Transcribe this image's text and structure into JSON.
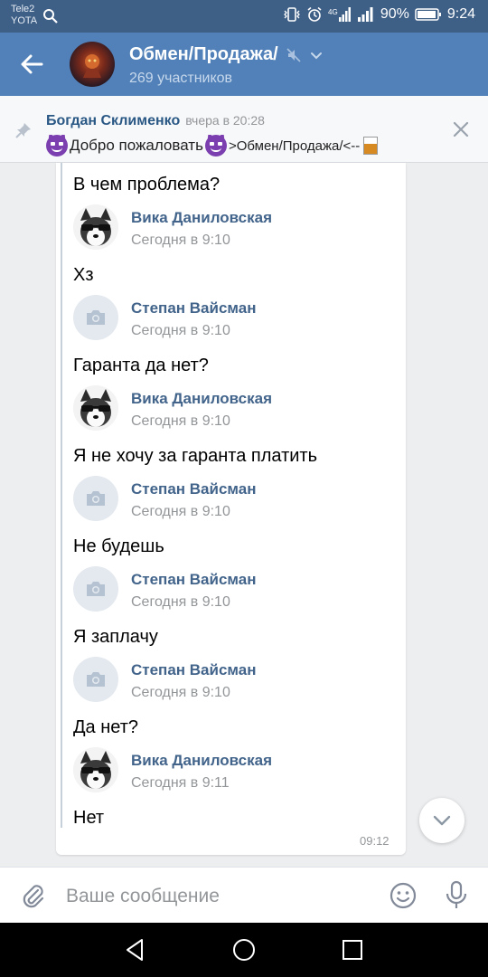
{
  "status_bar": {
    "carrier_line1": "Tele2",
    "carrier_line2": "YOTA",
    "battery": "90%",
    "time": "9:24"
  },
  "header": {
    "title": "Обмен/Продажа/",
    "subtitle": "269 участников",
    "back_icon": "arrow-left-icon",
    "mute_icon": "muted-speaker-icon",
    "dropdown_icon": "chevron-down-icon"
  },
  "pinned": {
    "author": "Богдан Склименко",
    "time": "вчера в 20:28",
    "text_part1": "Добро пожаловать",
    "text_part2": ">Обмен/Продажа/<--"
  },
  "thread": [
    {
      "type": "text",
      "text": "В чем проблема?"
    },
    {
      "type": "author",
      "name": "Вика Даниловская",
      "date": "Сегодня в 9:10",
      "avatar": "dog-sunglasses"
    },
    {
      "type": "text",
      "text": "Хз"
    },
    {
      "type": "author",
      "name": "Степан Вайсман",
      "date": "Сегодня в 9:10",
      "avatar": "camera-placeholder"
    },
    {
      "type": "text",
      "text": "Гаранта да нет?"
    },
    {
      "type": "author",
      "name": "Вика Даниловская",
      "date": "Сегодня в 9:10",
      "avatar": "dog-sunglasses"
    },
    {
      "type": "text",
      "text": "Я не хочу за гаранта платить"
    },
    {
      "type": "author",
      "name": "Степан Вайсман",
      "date": "Сегодня в 9:10",
      "avatar": "camera-placeholder"
    },
    {
      "type": "text",
      "text": "Не будешь"
    },
    {
      "type": "author",
      "name": "Степан Вайсман",
      "date": "Сегодня в 9:10",
      "avatar": "camera-placeholder"
    },
    {
      "type": "text",
      "text": "Я заплачу"
    },
    {
      "type": "author",
      "name": "Степан Вайсман",
      "date": "Сегодня в 9:10",
      "avatar": "camera-placeholder"
    },
    {
      "type": "text",
      "text": "Да нет?"
    },
    {
      "type": "author",
      "name": "Вика Даниловская",
      "date": "Сегодня в 9:11",
      "avatar": "dog-sunglasses"
    },
    {
      "type": "text",
      "text": "Нет"
    }
  ],
  "message_time": "09:12",
  "composer": {
    "placeholder": "Ваше сообщение"
  },
  "colors": {
    "header_bg": "#5181b8",
    "status_bg": "#3e5f86",
    "author_name": "#42648b",
    "pinned_name": "#2a5885"
  }
}
